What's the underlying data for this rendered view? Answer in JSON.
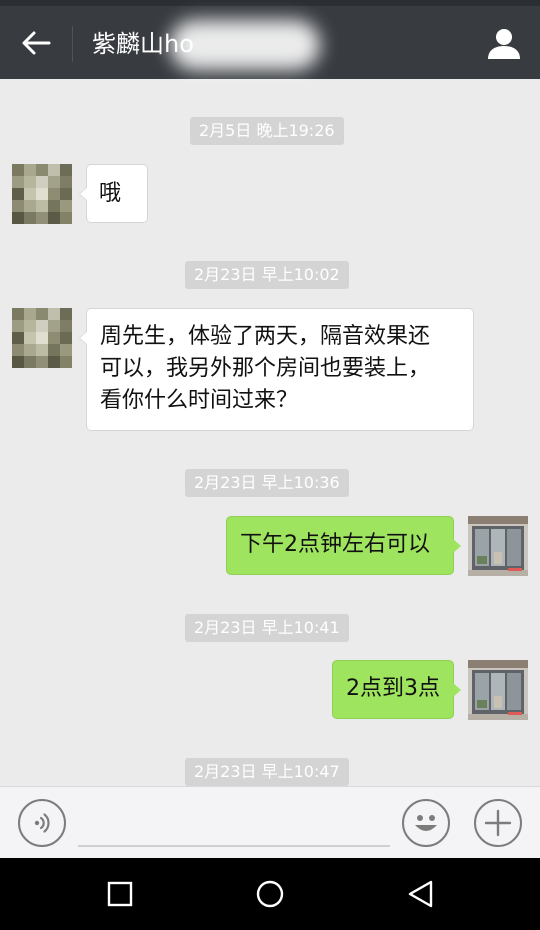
{
  "header": {
    "title": "紫麟山ho",
    "back_icon": "arrow-left-icon",
    "profile_icon": "person-icon"
  },
  "messages": [
    {
      "type": "timestamp",
      "text": "2月5日 晚上19:26"
    },
    {
      "type": "received",
      "text": "哦"
    },
    {
      "type": "timestamp",
      "text": "2月23日 早上10:02"
    },
    {
      "type": "received",
      "lines": [
        "周先生，体验了两天，隔音效果还",
        "可以，我另外那个房间也要装上，",
        "看你什么时间过来？"
      ]
    },
    {
      "type": "timestamp",
      "text": "2月23日 早上10:36"
    },
    {
      "type": "sent",
      "text": "下午2点钟左右可以"
    },
    {
      "type": "timestamp",
      "text": "2月23日 早上10:41"
    },
    {
      "type": "sent",
      "text": "2点到3点"
    },
    {
      "type": "timestamp",
      "text": "2月23日 早上10:47"
    }
  ],
  "inputbar": {
    "voice_icon": "voice-icon",
    "emoji_icon": "emoji-smile-icon",
    "plus_icon": "plus-icon"
  },
  "navbar": {
    "icons": [
      "square-recents-icon",
      "circle-home-icon",
      "triangle-back-icon"
    ]
  },
  "colors": {
    "header_bg": "#383c41",
    "chat_bg": "#ebebeb",
    "sent_bubble": "#9fe45e",
    "received_bubble": "#ffffff",
    "timestamp_bg": "#d4d4d4"
  }
}
